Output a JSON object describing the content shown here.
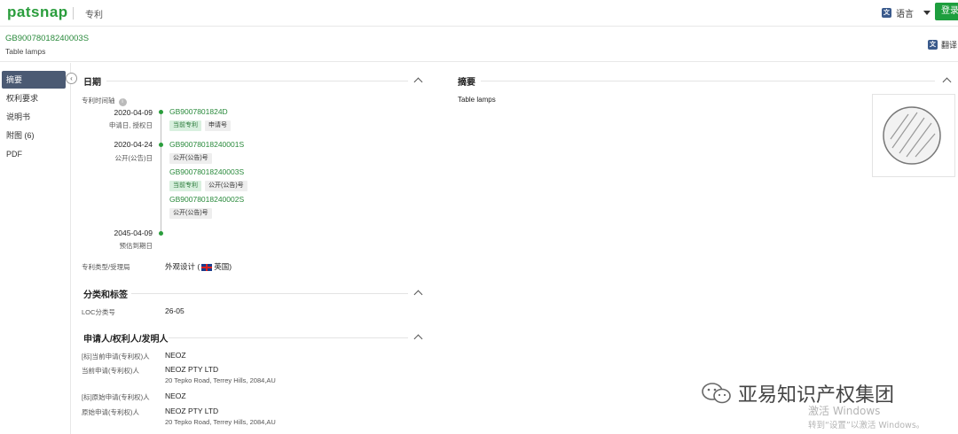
{
  "topbar": {
    "logo": "patsnap",
    "module": "专利",
    "language_label": "语言",
    "login_label": "登录"
  },
  "subheader": {
    "pub_number": "GB90078018240003S",
    "title": "Table lamps",
    "translate_label": "翻译"
  },
  "sidebar": {
    "items": [
      {
        "label": "摘要",
        "active": true
      },
      {
        "label": "权利要求"
      },
      {
        "label": "说明书"
      },
      {
        "label": "附图 (6)"
      },
      {
        "label": "PDF"
      }
    ]
  },
  "dates": {
    "heading": "日期",
    "timeline_label": "专利时间轴",
    "events": [
      {
        "date": "2020-04-09",
        "sub": "申请日, 授权日"
      },
      {
        "date": "2020-04-24",
        "sub": "公开(公告)日"
      },
      {
        "date": "2045-04-09",
        "sub": "预估到期日"
      }
    ],
    "patents": [
      {
        "number": "GB9007801824D",
        "tags": [
          "当前专利",
          "申请号"
        ]
      },
      {
        "number": "GB90078018240001S",
        "tags": [
          "公开(公告)号"
        ]
      },
      {
        "number": "GB90078018240003S",
        "tags": [
          "当前专利",
          "公开(公告)号"
        ]
      },
      {
        "number": "GB90078018240002S",
        "tags": [
          "公开(公告)号"
        ]
      }
    ],
    "type_label": "专利类型/受理局",
    "type_value": "外观设计 (",
    "type_country": "英国)"
  },
  "classification": {
    "heading": "分类和标签",
    "loc_label": "LOC分类号",
    "loc_value": "26-05"
  },
  "parties": {
    "heading": "申请人/权利人/发明人",
    "rows": [
      {
        "label": "[标]当前申请(专利权)人",
        "value": "NEOZ",
        "address": ""
      },
      {
        "label": "当前申请(专利权)人",
        "value": "NEOZ PTY LTD",
        "address": "20 Tepko Road, Terrey Hills, 2084,AU"
      },
      {
        "label": "[标]原始申请(专利权)人",
        "value": "NEOZ",
        "address": ""
      },
      {
        "label": "原始申请(专利权)人",
        "value": "NEOZ PTY LTD",
        "address": "20 Tepko Road, Terrey Hills, 2084,AU"
      }
    ]
  },
  "abstract": {
    "heading": "摘要",
    "text": "Table lamps"
  },
  "watermarks": {
    "company": "亚易知识产权集团",
    "activate_title": "激活 Windows",
    "activate_sub": "转到“设置”以激活 Windows。"
  },
  "colors": {
    "brand_green": "#2a9d3c",
    "sidebar_active": "#4b5a73",
    "login_bg": "#1e9e3e"
  }
}
